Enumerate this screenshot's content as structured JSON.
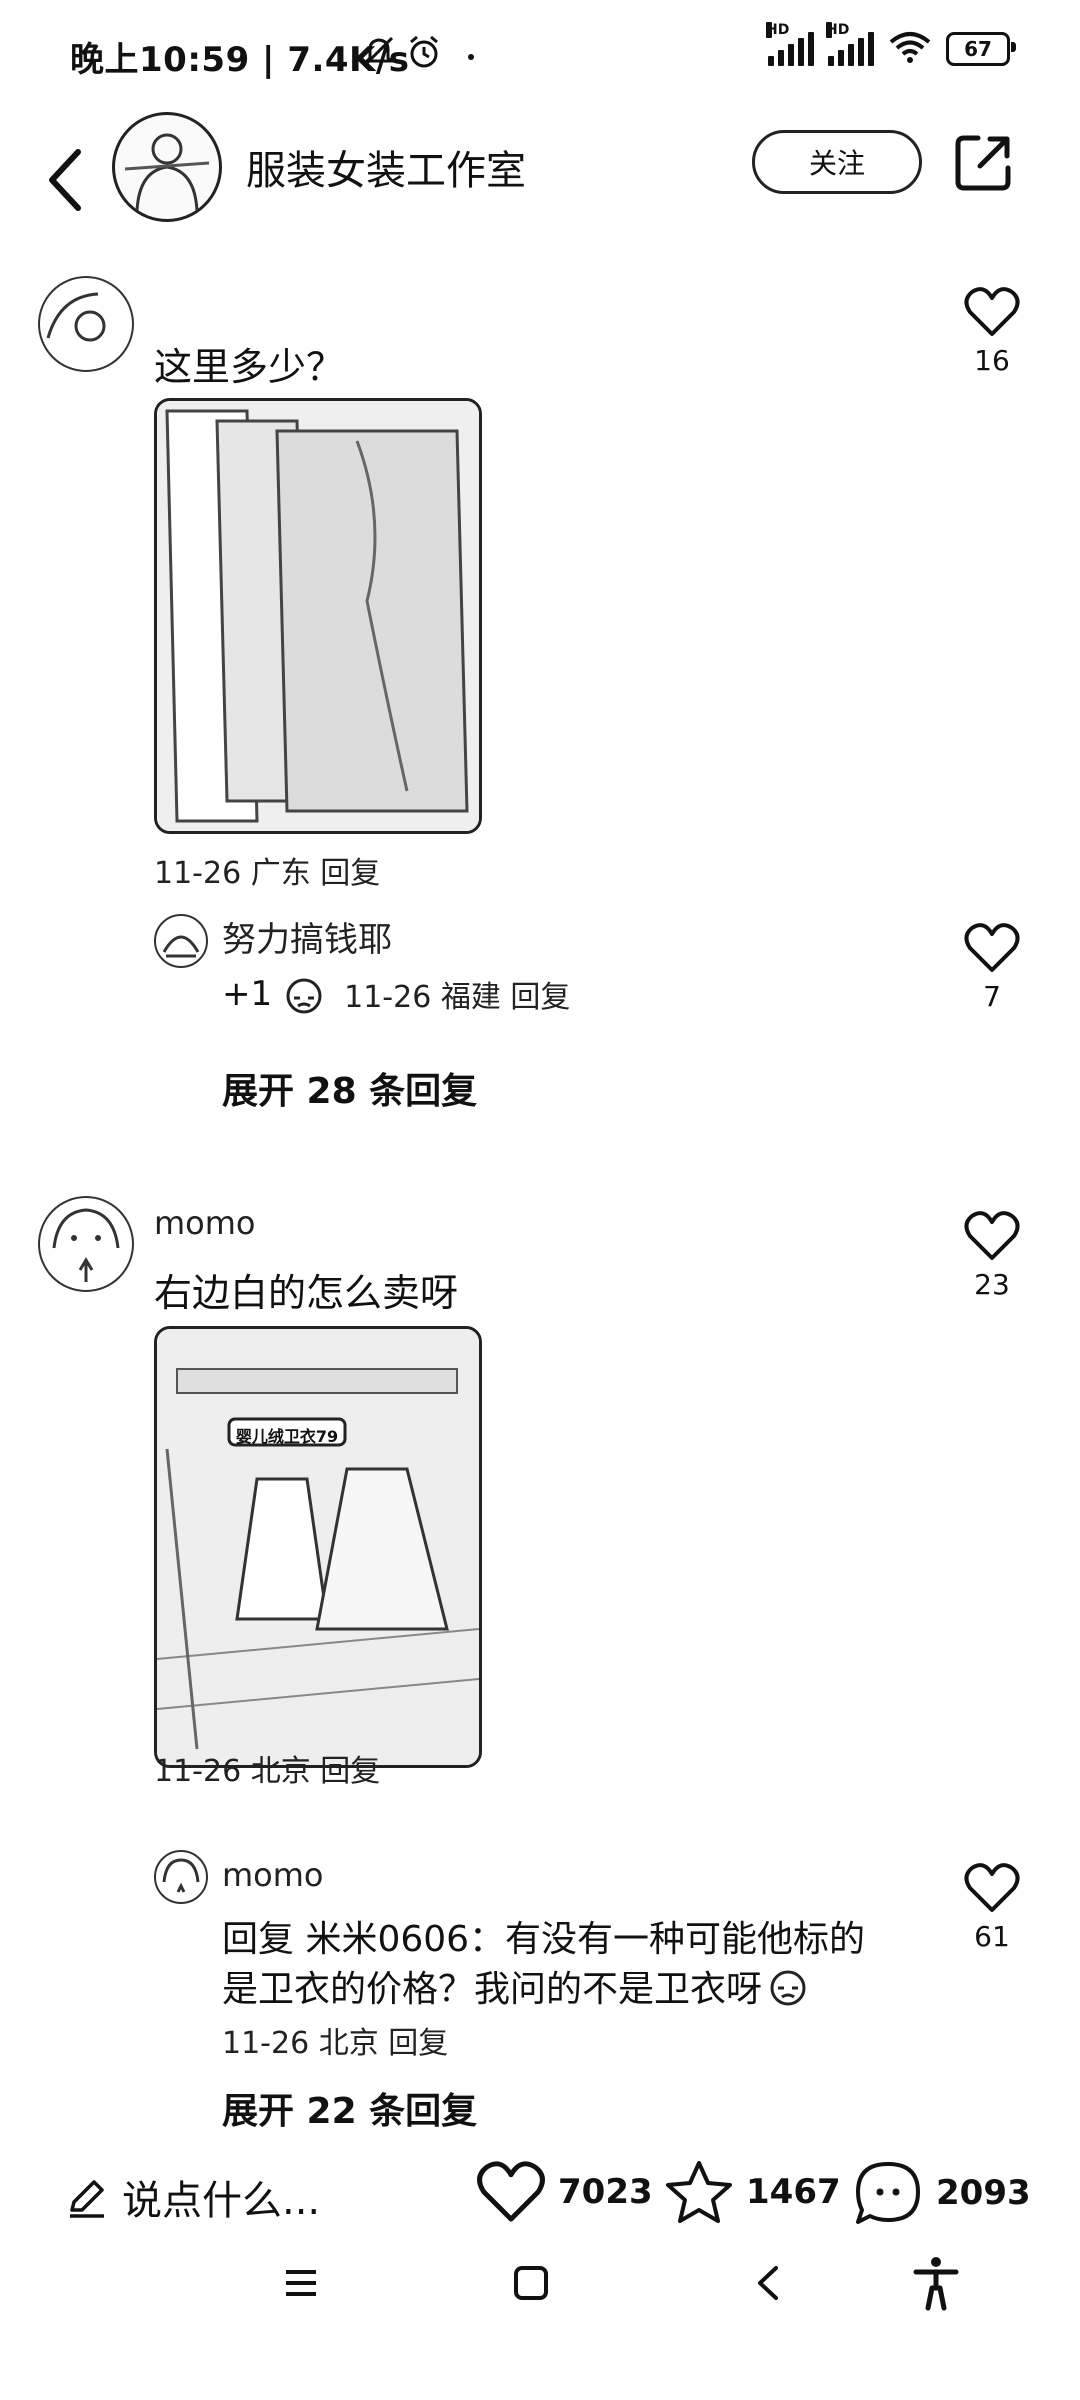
{
  "status": {
    "text": "晚上10:59 | 7.4K/s",
    "hd1": "HD",
    "hd2": "HD",
    "battery": "67"
  },
  "header": {
    "title": "服装女装工作室",
    "follow_label": "关注"
  },
  "comments": [
    {
      "name": "",
      "text": "这里多少？",
      "meta": "11-26 广东 回复",
      "likes": "16",
      "reply": {
        "name": "努力搞钱耶",
        "text": "+1",
        "meta": "11-26 福建 回复",
        "likes": "7"
      },
      "expand": "展开 28 条回复"
    },
    {
      "name": "momo",
      "text": "右边白的怎么卖呀",
      "photo_caption": "婴儿绒卫衣79",
      "meta": "11-26 北京 回复",
      "likes": "23",
      "reply": {
        "name": "momo",
        "text_line1": "回复  米米0606：有没有一种可能他标的",
        "text_line2": "是卫衣的价格？我问的不是卫衣呀",
        "meta": "11-26 北京 回复",
        "likes": "61"
      },
      "expand": "展开 22 条回复"
    }
  ],
  "bottom_bar": {
    "input_placeholder": "说点什么...",
    "likes": "7023",
    "favorites": "1467",
    "comments": "2093"
  },
  "icons": {
    "back": "chevron-left-icon",
    "share": "share-icon",
    "like": "heart-icon",
    "favorite": "star-icon",
    "comment": "chat-bubble-icon",
    "edit": "pencil-icon"
  }
}
